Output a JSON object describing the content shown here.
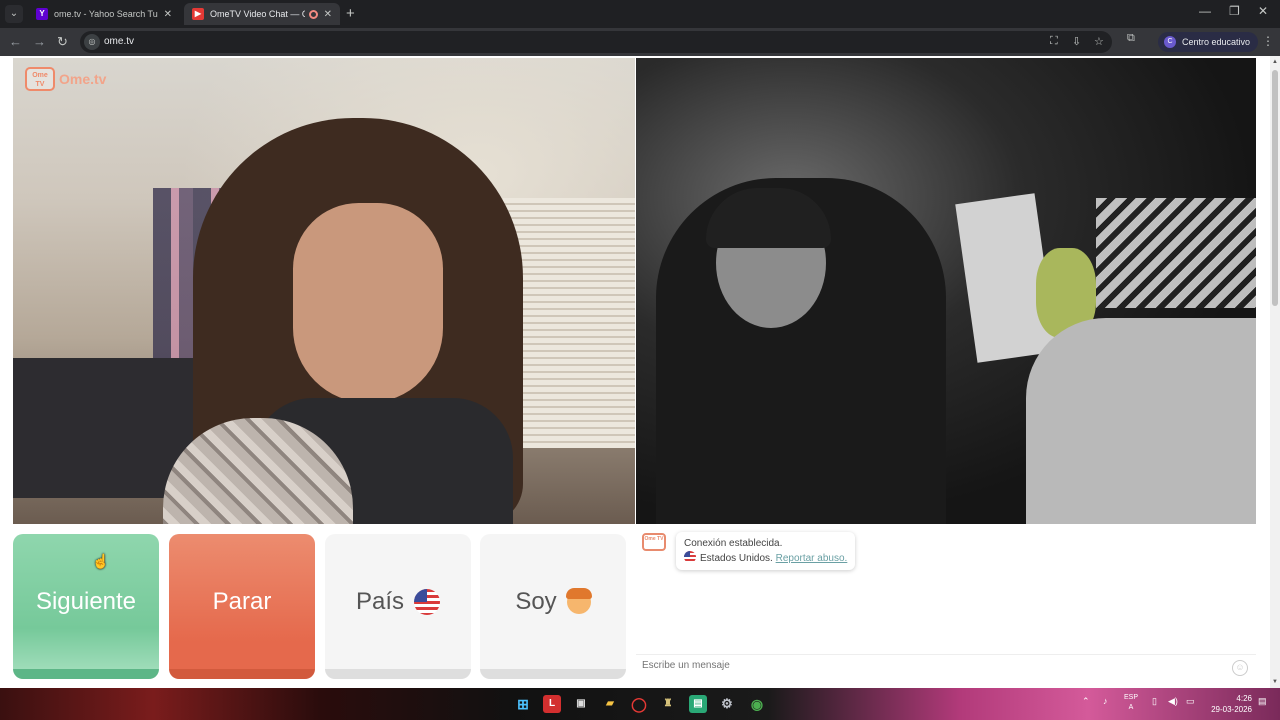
{
  "browser": {
    "tabs": [
      {
        "title": "ome.tv - Yahoo Search Tus resu",
        "favicon": "yahoo-icon"
      },
      {
        "title": "OmeTV Video Chat — Ome",
        "favicon": "ometv-icon",
        "active": true
      }
    ],
    "url": "ome.tv",
    "profile_label": "Centro educativo",
    "profile_initial": "C"
  },
  "app": {
    "logo_box_text": "Ome TV",
    "logo_text": "Ome.tv"
  },
  "buttons": {
    "next": "Siguiente",
    "stop": "Parar",
    "country": "País",
    "gender": "Soy"
  },
  "chat": {
    "logo_text": "Ome TV",
    "status": "Conexión establecida.",
    "country": "Estados Unidos.",
    "report": "Reportar abuso.",
    "input_placeholder": "Escribe un mensaje"
  },
  "taskbar": {
    "lang_top": "ESP",
    "lang_bottom": "A",
    "time": "4:26",
    "date": "29-03-2026"
  },
  "colors": {
    "next_button": "#76c99a",
    "stop_button": "#e5694c",
    "brand_accent": "#ef8a6a"
  }
}
